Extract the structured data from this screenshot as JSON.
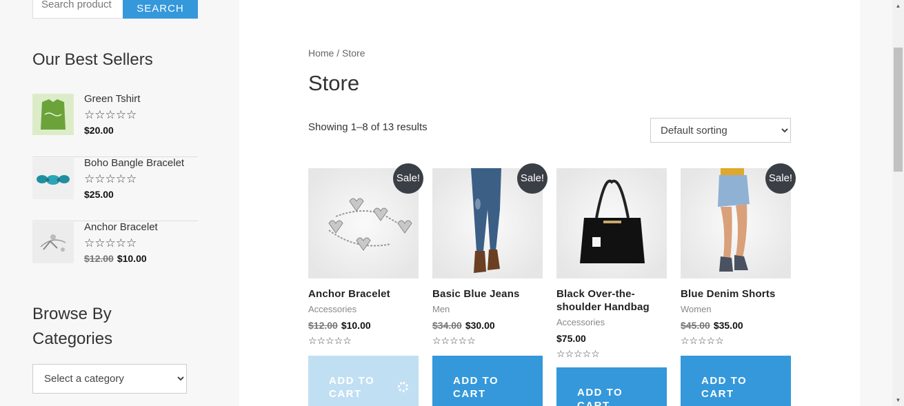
{
  "search": {
    "placeholder": "Search product",
    "button_label": "SEARCH"
  },
  "best_sellers": {
    "title": "Our Best Sellers",
    "items": [
      {
        "name": "Green Tshirt",
        "stars": "☆☆☆☆☆",
        "old_price": "",
        "price": "$20.00",
        "thumb_icon": "green-tshirt"
      },
      {
        "name": "Boho Bangle Bracelet",
        "stars": "☆☆☆☆☆",
        "old_price": "",
        "price": "$25.00",
        "thumb_icon": "bangle-bracelet"
      },
      {
        "name": "Anchor Bracelet",
        "stars": "☆☆☆☆☆",
        "old_price": "$12.00",
        "price": "$10.00",
        "thumb_icon": "anchor-bracelet"
      }
    ]
  },
  "categories_widget": {
    "title": "Browse By Categories",
    "select_value": "Select a category"
  },
  "breadcrumb": {
    "home": "Home",
    "sep": " / ",
    "current": "Store"
  },
  "page_title": "Store",
  "result_count": "Showing 1–8 of 13 results",
  "orderby": {
    "selected": "Default sorting"
  },
  "products": [
    {
      "title": "Anchor Bracelet",
      "category": "Accessories",
      "old_price": "$12.00",
      "price": "$10.00",
      "sale": "Sale!",
      "stars": "☆☆☆☆☆",
      "button": "ADD TO CART",
      "image_icon": "heart-charm-bracelet"
    },
    {
      "title": "Basic Blue Jeans",
      "category": "Men",
      "old_price": "$34.00",
      "price": "$30.00",
      "sale": "Sale!",
      "stars": "☆☆☆☆☆",
      "button": "ADD TO CART",
      "image_icon": "jeans"
    },
    {
      "title": "Black Over-the-shoulder Handbag",
      "category": "Accessories",
      "old_price": "",
      "price": "$75.00",
      "sale": "",
      "stars": "☆☆☆☆☆",
      "button": "ADD TO CART",
      "image_icon": "handbag"
    },
    {
      "title": "Blue Denim Shorts",
      "category": "Women",
      "old_price": "$45.00",
      "price": "$35.00",
      "sale": "Sale!",
      "stars": "☆☆☆☆☆",
      "button": "ADD TO CART",
      "image_icon": "denim-shorts"
    }
  ],
  "colors": {
    "accent": "#3498db",
    "accent_loading": "#c1dff3",
    "sale_badge": "#3a3f46"
  }
}
